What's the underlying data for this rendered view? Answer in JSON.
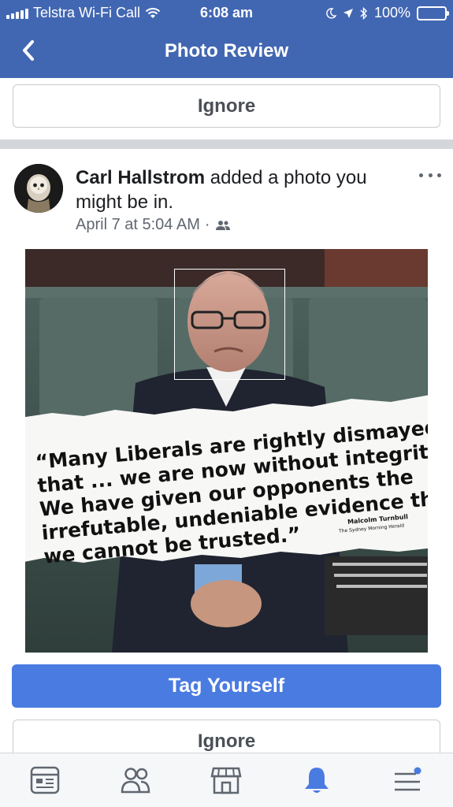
{
  "status_bar": {
    "carrier": "Telstra Wi-Fi Call",
    "time": "6:08 am",
    "battery": "100%"
  },
  "nav": {
    "title": "Photo Review",
    "back_icon": "chevron-left-icon"
  },
  "top_ignore_label": "Ignore",
  "post": {
    "author": "Carl Hallstrom",
    "action": "added a photo you might be in.",
    "date": "April 7 at 5:04 AM",
    "separator": "·",
    "audience_icon": "friends-icon",
    "more_icon": "more-options-icon"
  },
  "photo": {
    "quote": "“Many Liberals are rightly dismayed that ... we are now without integrity. We have given our opponents the irrefutable, undeniable evidence that we cannot be trusted.”",
    "quote_lines": [
      "“Many Liberals are rightly dismayed",
      "that ... we are now without integrity.",
      "We have given our opponents the",
      "irrefutable, undeniable evidence that",
      "we cannot be trusted.”"
    ],
    "attribution_name": "Malcolm Turnbull",
    "attribution_source": "The Sydney Morning Herald"
  },
  "actions": {
    "tag_yourself_label": "Tag Yourself",
    "ignore_label": "Ignore"
  },
  "tabbar": {
    "active_color": "#4a7be0",
    "tabs": [
      "news-feed-icon",
      "friends-icon",
      "marketplace-icon",
      "notifications-bell-icon",
      "menu-icon"
    ]
  },
  "colors": {
    "header_bg": "#4267b2",
    "primary_button": "#4a7be0"
  }
}
